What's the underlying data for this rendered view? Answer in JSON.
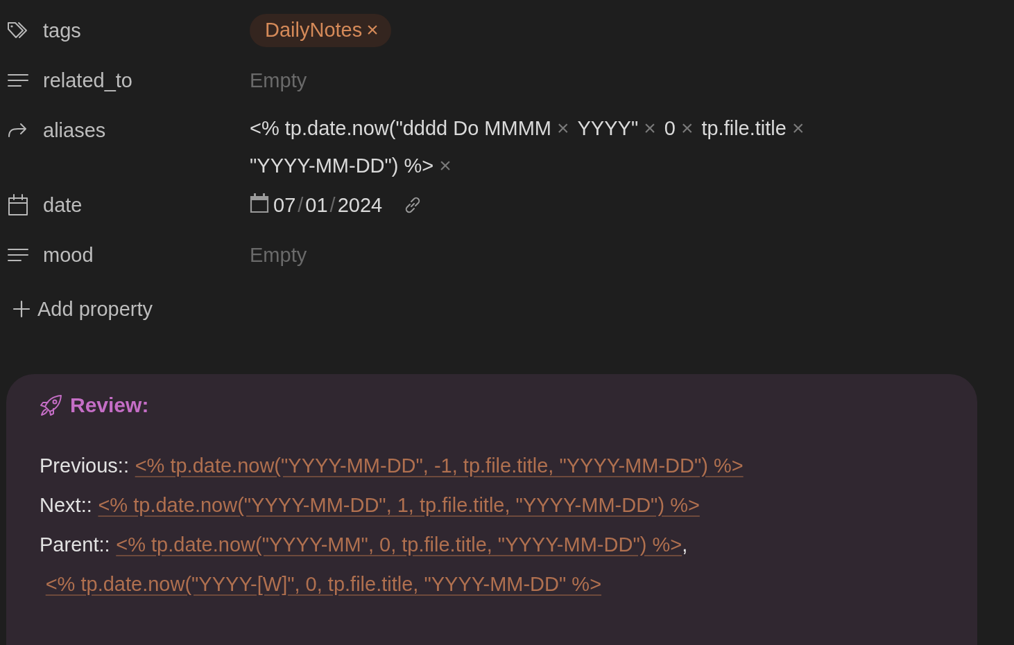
{
  "properties": [
    {
      "kind": "tags",
      "name": "tags",
      "values": [
        {
          "label": "DailyNotes",
          "remove": "×"
        }
      ]
    },
    {
      "kind": "text",
      "name": "related_to",
      "placeholder": "Empty"
    },
    {
      "kind": "list",
      "name": "aliases",
      "values": [
        {
          "label": "<% tp.date.now(\"dddd Do MMMM",
          "remove": "×"
        },
        {
          "label": "YYYY\"",
          "remove": "×"
        },
        {
          "label": "0",
          "remove": "×"
        },
        {
          "label": "tp.file.title",
          "remove": "×"
        },
        {
          "label": "\"YYYY-MM-DD\") %>",
          "remove": "×"
        }
      ]
    },
    {
      "kind": "date",
      "name": "date",
      "parts": [
        "07",
        "01",
        "2024"
      ],
      "separator": "/"
    },
    {
      "kind": "text",
      "name": "mood",
      "placeholder": "Empty"
    }
  ],
  "add_property": {
    "label": "Add property"
  },
  "callout": {
    "title": "Review:",
    "lines": [
      {
        "parts": [
          {
            "kind": "label",
            "text": "Previous::"
          },
          {
            "kind": "link",
            "text": "<% tp.date.now(\"YYYY-MM-DD\", -1, tp.file.title, \"YYYY-MM-DD\") %>"
          }
        ]
      },
      {
        "parts": [
          {
            "kind": "label",
            "text": "Next::"
          },
          {
            "kind": "link",
            "text": "<% tp.date.now(\"YYYY-MM-DD\", 1, tp.file.title, \"YYYY-MM-DD\") %>"
          }
        ]
      },
      {
        "parts": [
          {
            "kind": "label",
            "text": "Parent::"
          },
          {
            "kind": "link",
            "text": "<% tp.date.now(\"YYYY-MM\", 0, tp.file.title, \"YYYY-MM-DD\") %>"
          },
          {
            "kind": "comma",
            "text": ","
          },
          {
            "kind": "link",
            "text": "<% tp.date.now(\"YYYY-[W]\", 0, tp.file.title, \"YYYY-MM-DD\" %>"
          }
        ]
      }
    ]
  }
}
